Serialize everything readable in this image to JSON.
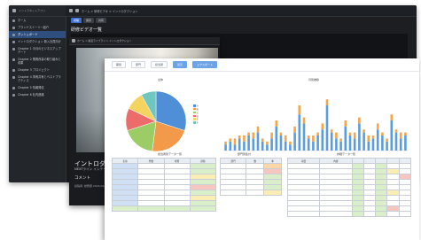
{
  "back_window": {
    "app_name": "イントラネットアプリ",
    "sidebar": [
      {
        "label": "ホーム",
        "active": false
      },
      {
        "label": "ブランドストーリー紹介",
        "active": false
      },
      {
        "label": "ダッシュボード",
        "active": true
      },
      {
        "label": "イントロダクション 新入社員向け",
        "active": false
      },
      {
        "label": "Chapter 1 今月のビジネスアップデート",
        "active": false
      },
      {
        "label": "Chapter 2 業務改善の取り組みと成果",
        "active": false
      },
      {
        "label": "Chapter 3 プロジェクト",
        "active": false
      },
      {
        "label": "Chapter 4 事例共有とベストプラクティス",
        "active": false
      },
      {
        "label": "Chapter 5 情報発信",
        "active": false
      },
      {
        "label": "Chapter 6 社内連絡",
        "active": false
      }
    ],
    "breadcrumb": "ホーム > 研修ビデオ > イントロダクション",
    "buttons": [
      "視聴",
      "保存",
      "共有"
    ],
    "title": "研修ビデオ一覧",
    "chapter_labels": [
      "Che",
      "Che"
    ]
  },
  "middle_window": {
    "breadcrumb": "ホーム > 動画ライブラリ > イントロダクション",
    "intro_title": "イントロダクション",
    "intro_subtitle": "NEXTライン インテーマ コミュニケーション",
    "comment_label": "コメント",
    "meta_text": "投稿者: 総務部 2024/04/01"
  },
  "front_window": {
    "filters": [
      "期間",
      "部門",
      "担当者",
      "表示",
      "エクスポート"
    ],
    "pie_title": "全体",
    "bar_title": "月別推移",
    "table1_title": "担当者別データ一覧",
    "table2_title": "部門別集計",
    "table3_title": "詳細データ一覧",
    "colors": {
      "accent": "#6fa3e8",
      "header": "#e9edf3"
    }
  },
  "chart_data": [
    {
      "type": "pie",
      "title": "全体",
      "categories": [
        "A",
        "B",
        "C",
        "D",
        "E",
        "F"
      ],
      "values": [
        30,
        22,
        18,
        12,
        10,
        8
      ]
    },
    {
      "type": "bar",
      "title": "月別推移",
      "categories": [
        "1",
        "2",
        "3",
        "4",
        "5",
        "6",
        "7",
        "8",
        "9",
        "10",
        "11",
        "12",
        "13",
        "14",
        "15",
        "16",
        "17",
        "18",
        "19",
        "20",
        "21",
        "22",
        "23",
        "24",
        "25",
        "26",
        "27",
        "28",
        "29",
        "30",
        "31",
        "32",
        "33",
        "34",
        "35",
        "36",
        "37",
        "38",
        "39",
        "40"
      ],
      "series": [
        {
          "values": [
            2,
            3,
            2,
            4,
            3,
            5,
            4,
            6,
            3,
            2,
            4,
            8,
            5,
            3,
            2,
            6,
            12,
            9,
            4,
            3,
            5,
            7,
            15,
            6,
            4,
            3,
            8,
            5,
            4,
            9,
            6,
            3,
            4,
            7,
            5,
            3,
            10,
            6,
            4,
            5
          ]
        },
        {
          "values": [
            1,
            1,
            2,
            1,
            2,
            1,
            2,
            2,
            1,
            1,
            2,
            2,
            1,
            2,
            1,
            2,
            3,
            2,
            1,
            2,
            1,
            2,
            2,
            1,
            2,
            1,
            2,
            1,
            2,
            2,
            1,
            2,
            1,
            2,
            1,
            1,
            2,
            1,
            2,
            1
          ]
        }
      ],
      "ylim": [
        0,
        20
      ]
    }
  ]
}
